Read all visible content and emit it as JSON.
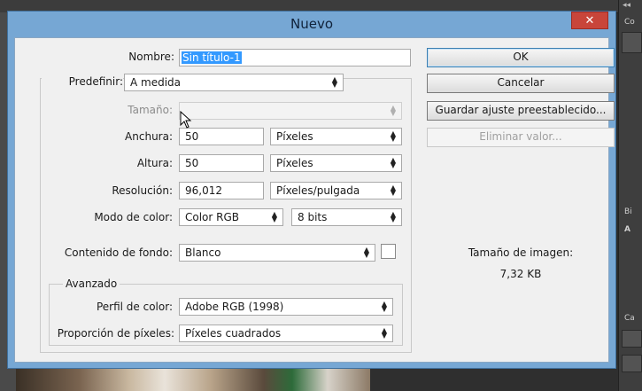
{
  "dialog": {
    "title": "Nuevo",
    "close_label": "✕"
  },
  "form": {
    "nombre_label": "Nombre:",
    "nombre_value": "Sin título-1",
    "predefinir_label": "Predefinir:",
    "predefinir_value": "A medida",
    "tamano_label": "Tamaño:",
    "tamano_value": "",
    "anchura_label": "Anchura:",
    "anchura_value": "50",
    "anchura_unit": "Píxeles",
    "altura_label": "Altura:",
    "altura_value": "50",
    "altura_unit": "Píxeles",
    "resolucion_label": "Resolución:",
    "resolucion_value": "96,012",
    "resolucion_unit": "Píxeles/pulgada",
    "modo_label": "Modo de color:",
    "modo_value": "Color RGB",
    "bits_value": "8 bits",
    "fondo_label": "Contenido de fondo:",
    "fondo_value": "Blanco",
    "avanzado_label": "Avanzado",
    "perfil_label": "Perfil de color:",
    "perfil_value": "Adobe RGB (1998)",
    "proporcion_label": "Proporción de píxeles:",
    "proporcion_value": "Píxeles cuadrados"
  },
  "buttons": {
    "ok": "OK",
    "cancelar": "Cancelar",
    "guardar": "Guardar ajuste preestablecido...",
    "eliminar": "Eliminar valor..."
  },
  "image_size": {
    "label": "Tamaño de imagen:",
    "value": "7,32 KB"
  },
  "background_app": {
    "collapse_glyph": "◂◂",
    "panel_labels": [
      "Co",
      "Bi",
      "A",
      "Ca"
    ]
  }
}
